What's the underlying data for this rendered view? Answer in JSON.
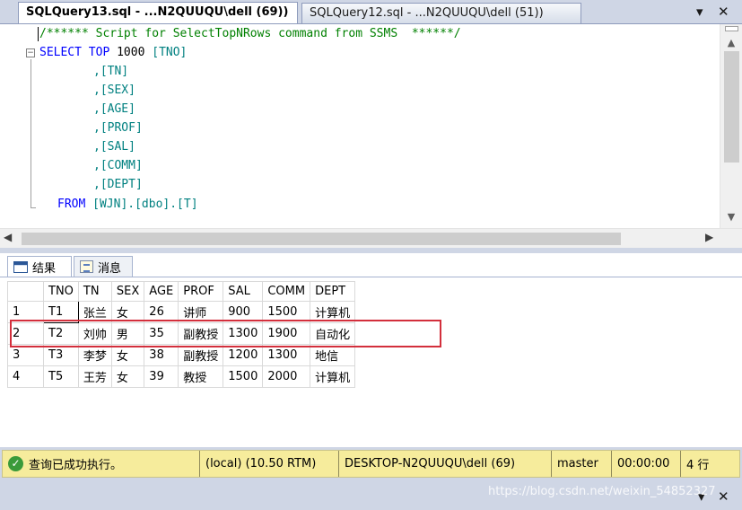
{
  "tabs": {
    "active_label": "SQLQuery13.sql - ...N2QUUQU\\dell (69))",
    "inactive_label": "SQLQuery12.sql - ...N2QUUQU\\dell (51))",
    "dropdown_glyph": "▾",
    "close_glyph": "✕"
  },
  "editor": {
    "comment": "/****** Script for SelectTopNRows command from SSMS  ******/",
    "select_kw": "SELECT",
    "top_kw": "TOP",
    "top_num": "1000",
    "first_col": "[TNO]",
    "columns": [
      ",[TN]",
      ",[SEX]",
      ",[AGE]",
      ",[PROF]",
      ",[SAL]",
      ",[COMM]",
      ",[DEPT]"
    ],
    "from_kw": "FROM",
    "from_table": "[WJN].[dbo].[T]",
    "collapse_glyph": "−"
  },
  "results_tabs": {
    "results_label": "结果",
    "messages_label": "消息"
  },
  "grid": {
    "headers": [
      "TNO",
      "TN",
      "SEX",
      "AGE",
      "PROF",
      "SAL",
      "COMM",
      "DEPT"
    ],
    "rows": [
      {
        "num": "1",
        "cells": [
          "T1",
          "张兰",
          "女",
          "26",
          "讲师",
          "900",
          "1500",
          "计算机"
        ]
      },
      {
        "num": "2",
        "cells": [
          "T2",
          "刘帅",
          "男",
          "35",
          "副教授",
          "1300",
          "1900",
          "自动化"
        ]
      },
      {
        "num": "3",
        "cells": [
          "T3",
          "李梦",
          "女",
          "38",
          "副教授",
          "1200",
          "1300",
          "地信"
        ]
      },
      {
        "num": "4",
        "cells": [
          "T5",
          "王芳",
          "女",
          "39",
          "教授",
          "1500",
          "2000",
          "计算机"
        ]
      }
    ]
  },
  "status": {
    "message": "查询已成功执行。",
    "server": "(local) (10.50 RTM)",
    "login": "DESKTOP-N2QUUQU\\dell (69)",
    "database": "master",
    "elapsed": "00:00:00",
    "row_count": "4 行"
  },
  "watermark": "https://blog.csdn.net/weixin_54852327",
  "colors": {
    "keyword": "#0000ff",
    "comment": "#008000",
    "identifier": "#008080",
    "status_bg": "#f6ec9c",
    "highlight": "#d32f3c"
  }
}
